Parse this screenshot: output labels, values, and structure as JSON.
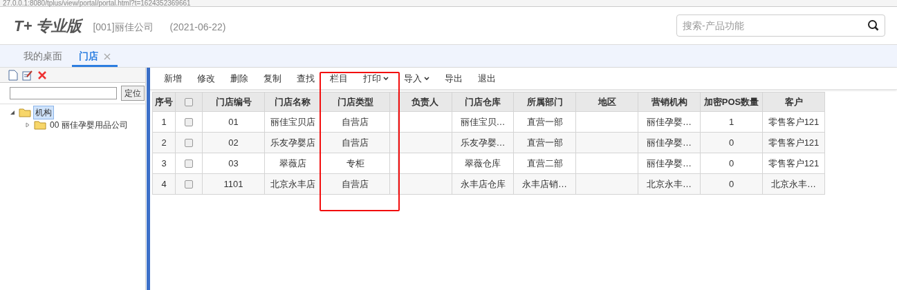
{
  "address_bar": {
    "url": "27.0.0.1:8080/tplus/view/portal/portal.html?t=1624352369661"
  },
  "header": {
    "logo": "T+ 专业版",
    "company": "[001]丽佳公司",
    "date": "(2021-06-22)",
    "search": {
      "placeholder": "搜索-产品功能"
    }
  },
  "tabs": [
    {
      "label": "我的桌面",
      "selected": false,
      "closable": false
    },
    {
      "label": "门店",
      "selected": true,
      "closable": true
    }
  ],
  "sidebar": {
    "locate_button": "定位",
    "tree": [
      {
        "label": "机构",
        "expanded": true,
        "selected": true,
        "children": [
          {
            "label": "00 丽佳孕婴用品公司",
            "expanded": false,
            "selected": false
          }
        ]
      }
    ]
  },
  "toolbar": [
    {
      "label": "新增",
      "has_menu": false
    },
    {
      "label": "修改",
      "has_menu": false
    },
    {
      "label": "删除",
      "has_menu": false
    },
    {
      "label": "复制",
      "has_menu": false
    },
    {
      "label": "查找",
      "has_menu": false
    },
    {
      "label": "栏目",
      "has_menu": false
    },
    {
      "label": "打印",
      "has_menu": true
    },
    {
      "label": "导入",
      "has_menu": true
    },
    {
      "label": "导出",
      "has_menu": false
    },
    {
      "label": "退出",
      "has_menu": false
    }
  ],
  "table": {
    "columns": [
      {
        "kind": "text",
        "label": "序号"
      },
      {
        "kind": "check",
        "checked": false
      },
      {
        "kind": "text",
        "label": "门店编号"
      },
      {
        "kind": "text",
        "label": "门店名称"
      },
      {
        "kind": "text",
        "label": "门店类型"
      },
      {
        "kind": "blank"
      },
      {
        "kind": "text",
        "label": "负责人"
      },
      {
        "kind": "text",
        "label": "门店仓库"
      },
      {
        "kind": "text",
        "label": "所属部门"
      },
      {
        "kind": "text",
        "label": "地区"
      },
      {
        "kind": "text",
        "label": "营销机构"
      },
      {
        "kind": "text",
        "label": "加密POS数量"
      },
      {
        "kind": "text",
        "label": "客户"
      }
    ],
    "rows": [
      {
        "cells": [
          {
            "kind": "text",
            "text": "1"
          },
          {
            "kind": "check",
            "checked": false
          },
          {
            "kind": "text",
            "text": "01"
          },
          {
            "kind": "text",
            "text": "丽佳宝贝店"
          },
          {
            "kind": "text",
            "text": "自营店"
          },
          {
            "kind": "empty"
          },
          {
            "kind": "empty"
          },
          {
            "kind": "text",
            "text": "丽佳宝贝…"
          },
          {
            "kind": "text",
            "text": "直营一部"
          },
          {
            "kind": "empty"
          },
          {
            "kind": "text",
            "text": "丽佳孕婴…"
          },
          {
            "kind": "text",
            "text": "1"
          },
          {
            "kind": "text",
            "text": "零售客户121"
          }
        ]
      },
      {
        "cells": [
          {
            "kind": "text",
            "text": "2"
          },
          {
            "kind": "check",
            "checked": false
          },
          {
            "kind": "text",
            "text": "02"
          },
          {
            "kind": "text",
            "text": "乐友孕婴店"
          },
          {
            "kind": "text",
            "text": "自营店"
          },
          {
            "kind": "empty"
          },
          {
            "kind": "empty"
          },
          {
            "kind": "text",
            "text": "乐友孕婴…"
          },
          {
            "kind": "text",
            "text": "直营一部"
          },
          {
            "kind": "empty"
          },
          {
            "kind": "text",
            "text": "丽佳孕婴…"
          },
          {
            "kind": "text",
            "text": "0"
          },
          {
            "kind": "text",
            "text": "零售客户121"
          }
        ]
      },
      {
        "cells": [
          {
            "kind": "text",
            "text": "3"
          },
          {
            "kind": "check",
            "checked": false
          },
          {
            "kind": "text",
            "text": "03"
          },
          {
            "kind": "text",
            "text": "翠薇店"
          },
          {
            "kind": "text",
            "text": "专柜"
          },
          {
            "kind": "empty"
          },
          {
            "kind": "empty"
          },
          {
            "kind": "text",
            "text": "翠薇仓库"
          },
          {
            "kind": "text",
            "text": "直营二部"
          },
          {
            "kind": "empty"
          },
          {
            "kind": "text",
            "text": "丽佳孕婴…"
          },
          {
            "kind": "text",
            "text": "0"
          },
          {
            "kind": "text",
            "text": "零售客户121"
          }
        ]
      },
      {
        "cells": [
          {
            "kind": "text",
            "text": "4"
          },
          {
            "kind": "check",
            "checked": false
          },
          {
            "kind": "text",
            "text": "1101"
          },
          {
            "kind": "text",
            "text": "北京永丰店"
          },
          {
            "kind": "text",
            "text": "自营店"
          },
          {
            "kind": "empty"
          },
          {
            "kind": "empty"
          },
          {
            "kind": "text",
            "text": "永丰店仓库"
          },
          {
            "kind": "text",
            "text": "永丰店销…"
          },
          {
            "kind": "empty"
          },
          {
            "kind": "text",
            "text": "北京永丰…"
          },
          {
            "kind": "text",
            "text": "0"
          },
          {
            "kind": "text",
            "text": "北京永丰…"
          }
        ]
      }
    ]
  }
}
